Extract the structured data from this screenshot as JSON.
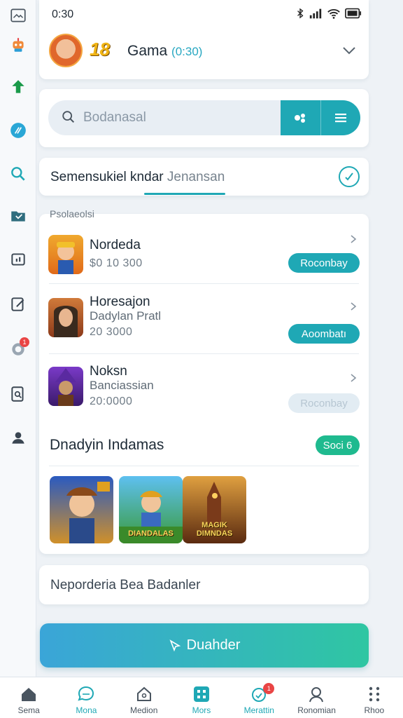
{
  "status_bar": {
    "time": "0:30"
  },
  "header": {
    "level": "18",
    "title": "Gama",
    "subtitle": "(0:30)"
  },
  "search": {
    "placeholder": "Bodanasal"
  },
  "tab_bar": {
    "label_main": "Semensukiel kndar",
    "label_secondary": "Jenansan"
  },
  "list": {
    "section_label": "Psolaeolsi",
    "items": [
      {
        "title": "Nordeda",
        "subtitle": "",
        "price": "$0 10 300",
        "action_label": "Roconbay",
        "action_enabled": true
      },
      {
        "title": "Horesajon",
        "subtitle": "Dadylan Pratl",
        "price": "20 3000",
        "action_label": "Aoombatı",
        "action_enabled": true
      },
      {
        "title": "Noksn",
        "subtitle": "Banciassian",
        "price": "20:0000",
        "action_label": "Roconbay",
        "action_enabled": false
      }
    ]
  },
  "featured": {
    "title": "Dnadyin Indamas",
    "social_label": "Soci 6",
    "tiles": [
      {
        "label": ""
      },
      {
        "label": "DIANDALAS"
      },
      {
        "label": "MAGIK DIMNDAS"
      }
    ]
  },
  "info_text": "Neporderia Bea Badanler",
  "cta_label": "Duahder",
  "bottom_nav": [
    {
      "label": "Sema",
      "icon": "home-icon",
      "active": false
    },
    {
      "label": "Mona",
      "icon": "chat-icon",
      "active": true
    },
    {
      "label": "Medion",
      "icon": "house-icon",
      "active": false
    },
    {
      "label": "Mors",
      "icon": "grid-icon",
      "active": true
    },
    {
      "label": "Merattin",
      "icon": "bell-icon",
      "active": true,
      "badge": "1"
    },
    {
      "label": "Ronomian",
      "icon": "profile-icon",
      "active": false
    },
    {
      "label": "Rhoo",
      "icon": "more-icon",
      "active": false
    }
  ],
  "rail": {
    "notification_badge": "1"
  },
  "colors": {
    "accent": "#1fa8b5",
    "success": "#1fba8f",
    "danger": "#e94545"
  }
}
